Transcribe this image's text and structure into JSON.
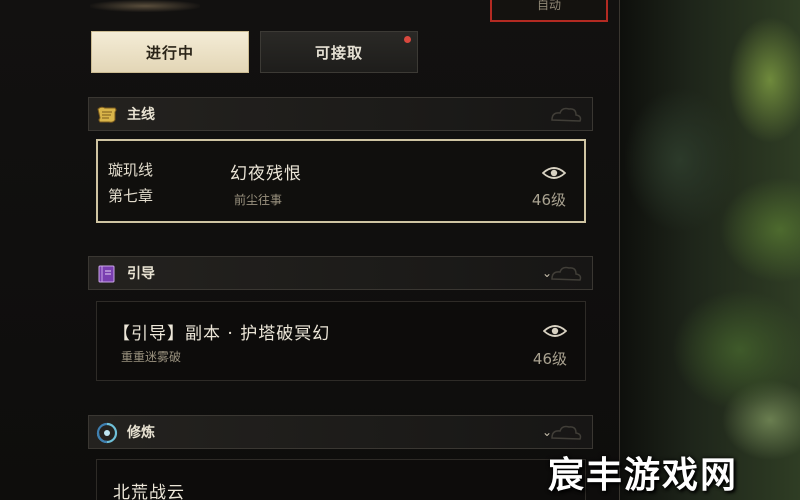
{
  "top_button": {
    "label": "自动"
  },
  "tabs": [
    {
      "label": "进行中",
      "active": true
    },
    {
      "label": "可接取",
      "active": false,
      "has_notification": true
    }
  ],
  "sections": [
    {
      "name": "主线",
      "icon": "scroll-icon",
      "quests": [
        {
          "chapter_line1": "璇玑线",
          "chapter_line2": "第七章",
          "title": "幻夜残恨",
          "subtitle": "前尘往事",
          "level": "46级",
          "selected": true
        }
      ]
    },
    {
      "name": "引导",
      "icon": "book-icon",
      "collapsible": true,
      "quests": [
        {
          "title": "【引导】副本 · 护塔破冥幻",
          "subtitle": "重重迷雾破",
          "level": "46级",
          "selected": false
        }
      ]
    },
    {
      "name": "修炼",
      "icon": "swirl-icon",
      "collapsible": true,
      "quests": [
        {
          "title": "北荒战云"
        }
      ]
    }
  ],
  "watermark": "宸丰游戏网",
  "colors": {
    "accent_red": "#b32a22",
    "tab_active_bg": "#f4ecd6",
    "notification_dot": "#d8483e"
  }
}
